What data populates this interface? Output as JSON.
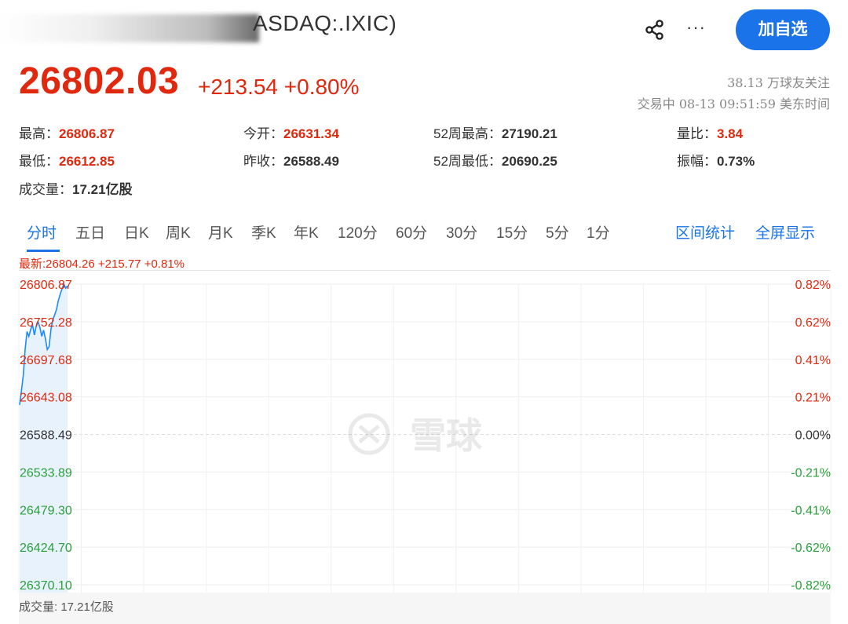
{
  "header": {
    "title": "ASDAQ:.IXIC)",
    "add_watchlist_label": "加自选",
    "more_label": "···"
  },
  "quote": {
    "price": "26802.03",
    "change": "+213.54 +0.80%",
    "followers": "38.13 万球友关注",
    "status": "交易中 08-13 09:51:59 美东时间"
  },
  "stats": {
    "high_label": "最高：",
    "high_value": "26806.87",
    "open_label": "今开：",
    "open_value": "26631.34",
    "wk52_high_label": "52周最高：",
    "wk52_high_value": "27190.21",
    "volume_ratio_label": "量比：",
    "volume_ratio_value": "3.84",
    "low_label": "最低：",
    "low_value": "26612.85",
    "prev_close_label": "昨收：",
    "prev_close_value": "26588.49",
    "wk52_low_label": "52周最低：",
    "wk52_low_value": "20690.25",
    "amplitude_label": "振幅：",
    "amplitude_value": "0.73%",
    "volume_label": "成交量：",
    "volume_value": "17.21亿股"
  },
  "tabs": [
    "分时",
    "五日",
    "日K",
    "周K",
    "月K",
    "季K",
    "年K",
    "120分",
    "60分",
    "30分",
    "15分",
    "5分",
    "1分"
  ],
  "active_tab": "分时",
  "right_tabs": [
    "区间统计",
    "全屏显示"
  ],
  "latest_line": "最新:26804.26 +215.77 +0.81%",
  "volume_footer": "成交量: 17.21亿股",
  "watermark": "雪球",
  "colors": {
    "up": "#e0280e",
    "down": "#2aa03b",
    "accent": "#1a73e8",
    "line": "#1a8cff"
  },
  "chart_data": {
    "type": "line",
    "title": "",
    "y_left_ticks": [
      "26806.87",
      "26752.28",
      "26697.68",
      "26643.08",
      "26588.49",
      "26533.89",
      "26479.30",
      "26424.70",
      "26370.10"
    ],
    "y_right_ticks": [
      "0.82%",
      "0.62%",
      "0.41%",
      "0.21%",
      "0.00%",
      "-0.21%",
      "-0.41%",
      "-0.62%",
      "-0.82%"
    ],
    "ylim": [
      26370.1,
      26806.87
    ],
    "baseline": 26588.49,
    "series": [
      {
        "values": [
          26631.34,
          26652,
          26675,
          26712,
          26738,
          26731,
          26741,
          26748,
          26733,
          26746,
          26752,
          26744,
          26731,
          26740,
          26728,
          26712,
          26716,
          26741,
          26755,
          26762,
          26770,
          26783,
          26792,
          26800,
          26806.87,
          26801,
          26804.26
        ]
      }
    ]
  }
}
